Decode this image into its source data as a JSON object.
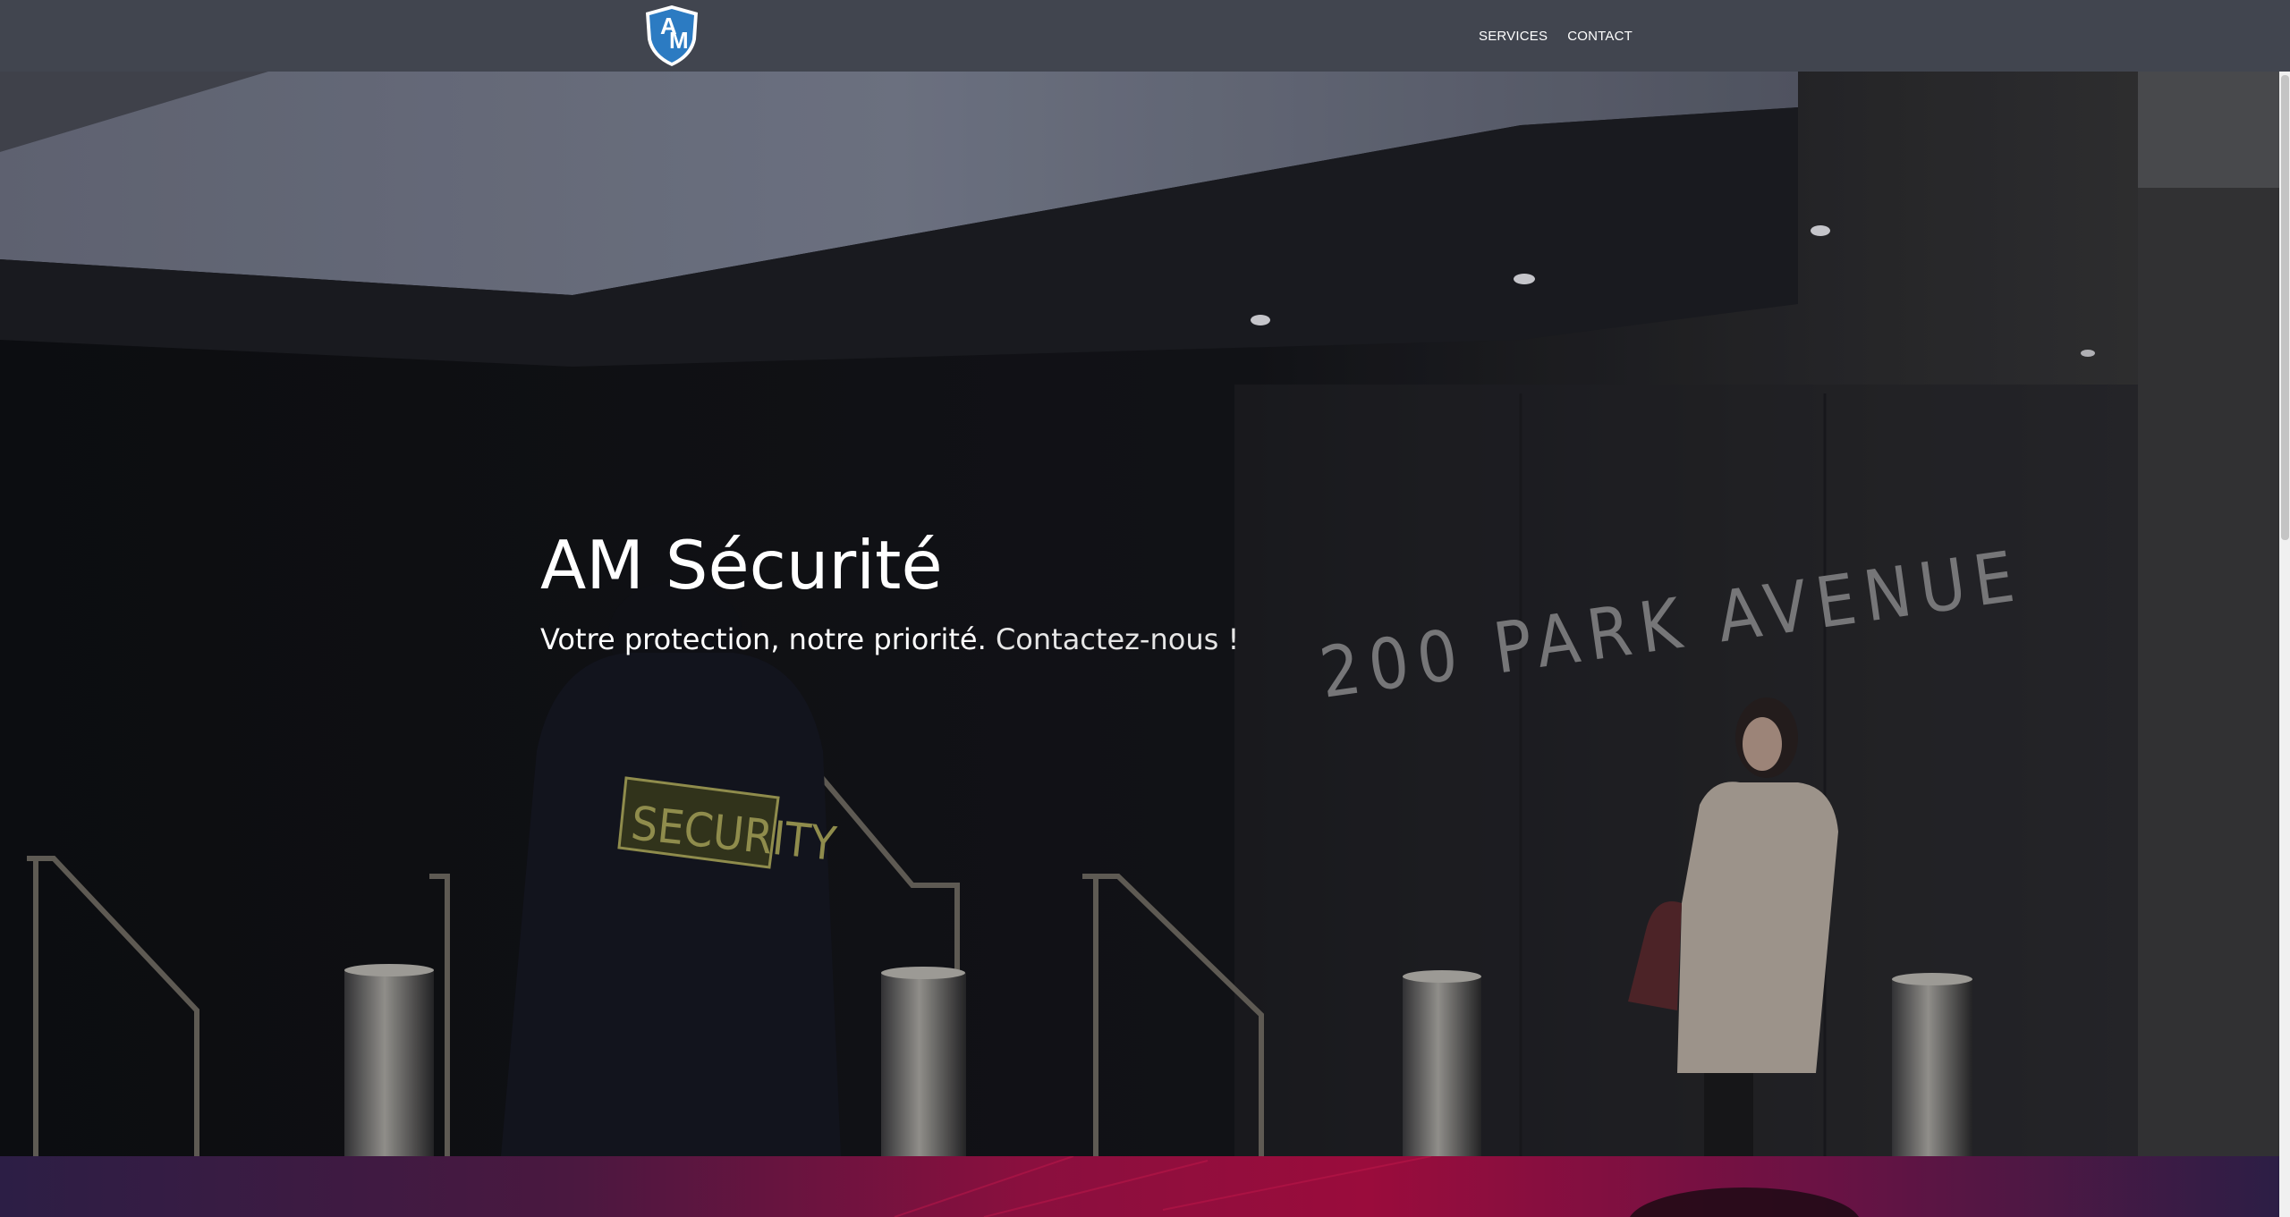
{
  "header": {
    "logo_text": "AM",
    "nav": [
      {
        "label": "SERVICES"
      },
      {
        "label": "CONTACT"
      }
    ]
  },
  "hero": {
    "title": "AM Sécurité",
    "subtitle": "Votre protection, notre priorité.",
    "cta": "Contactez-nous !",
    "background_words": {
      "building_sign": "200 PARK AVENUE",
      "jacket_patch": "SECURITY"
    }
  },
  "colors": {
    "header_bg": "#41454f",
    "logo_blue": "#2c7bc2",
    "accent_magenta": "#9a0c3c"
  }
}
